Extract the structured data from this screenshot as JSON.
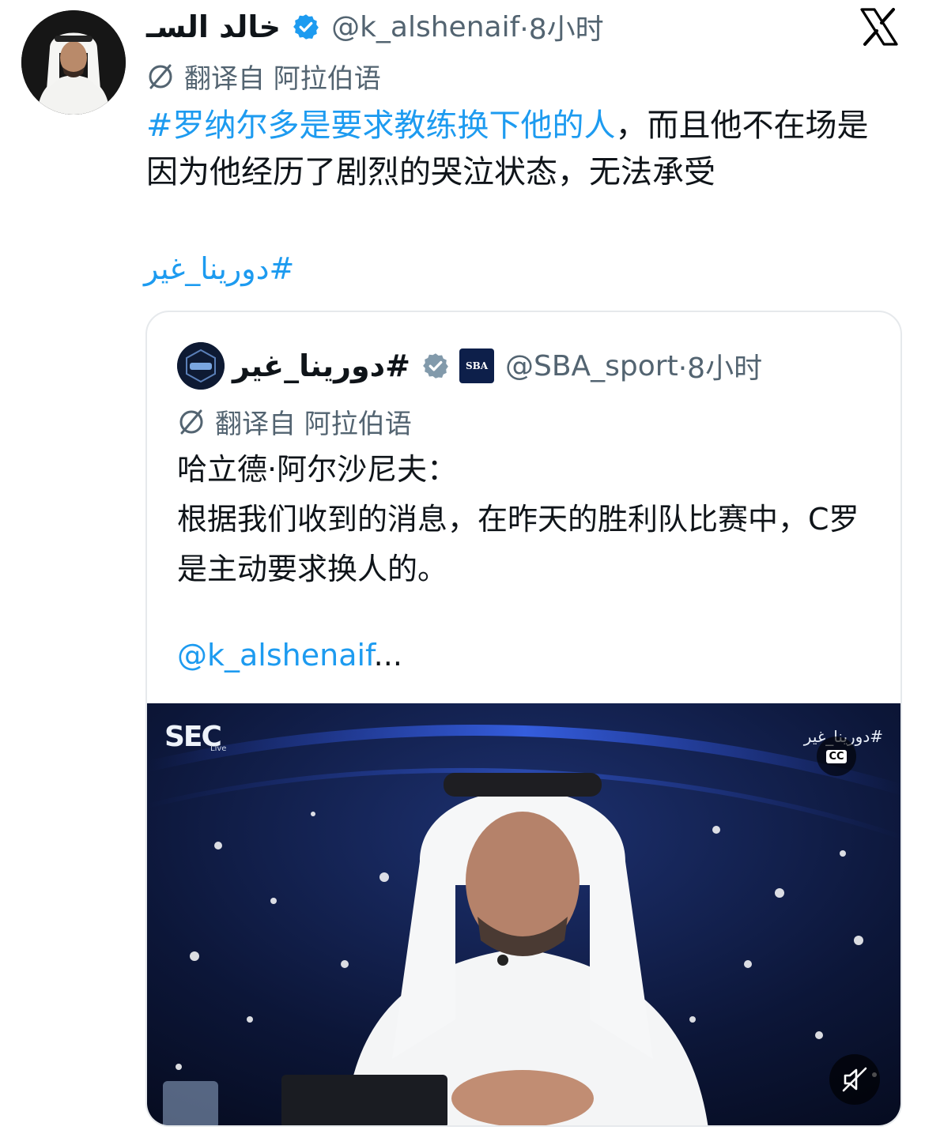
{
  "tweet": {
    "display_name": "خالد السـ",
    "handle": "@k_alshenaif",
    "time": "·8小时",
    "translated_from": "翻译自 阿拉伯语",
    "text_link": "#罗纳尔多是要求教练换下他的人",
    "text_rest": "，而且他不在场是因为他经历了剧烈的哭泣状态，无法承受",
    "hashtag": "#دورينا_غير"
  },
  "quoted_tweet": {
    "display_name": "#دورينا_غير",
    "badge_label": "SBA",
    "handle": "@SBA_sport",
    "time": "·8小时",
    "translated_from": "翻译自 阿拉伯语",
    "text": "哈立德·阿尔沙尼夫：\n根据我们收到的消息，在昨天的胜利队比赛中，C罗是主动要求换人的。",
    "mention": "@k_alshenaif",
    "ellipsis": "...",
    "video": {
      "logo": "SEC",
      "logo_sub": "Live",
      "watermark": "#دورينا_غير",
      "cc_label": "CC"
    }
  },
  "icons": {
    "platform": "x-logo-icon",
    "verified": "verified-badge-icon",
    "translate": "translate-icon",
    "captions": "cc-icon",
    "mute": "speaker-muted-icon"
  },
  "colors": {
    "link": "#1d9bf0",
    "secondary_text": "#536471",
    "primary_text": "#0f1419",
    "quote_border": "#e6e9ec"
  }
}
